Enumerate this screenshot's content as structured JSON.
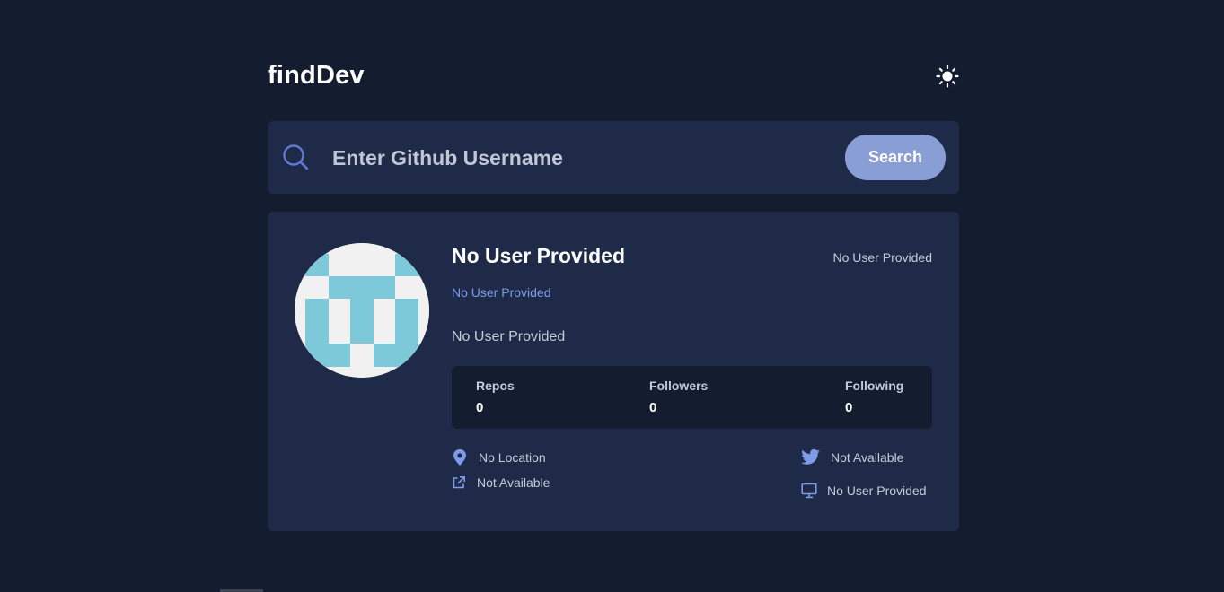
{
  "app": {
    "logo": "findDev",
    "theme_icon": "sun-icon"
  },
  "search": {
    "placeholder": "Enter Github Username",
    "value": "",
    "button_label": "Search",
    "icon": "search-icon"
  },
  "profile": {
    "name": "No User Provided",
    "joined": "No User Provided",
    "login": "No User Provided",
    "bio": "No User Provided",
    "stats": [
      {
        "label": "Repos",
        "value": "0"
      },
      {
        "label": "Followers",
        "value": "0"
      },
      {
        "label": "Following",
        "value": "0"
      }
    ],
    "location": "No Location",
    "blog": "Not Available",
    "twitter": "Not Available",
    "company": "No User Provided"
  },
  "colors": {
    "background": "#141d2f",
    "card": "#1e2a47",
    "accent": "#8a9ed6",
    "link": "#7e9be6",
    "avatar_pattern": "#7ec9d9"
  }
}
